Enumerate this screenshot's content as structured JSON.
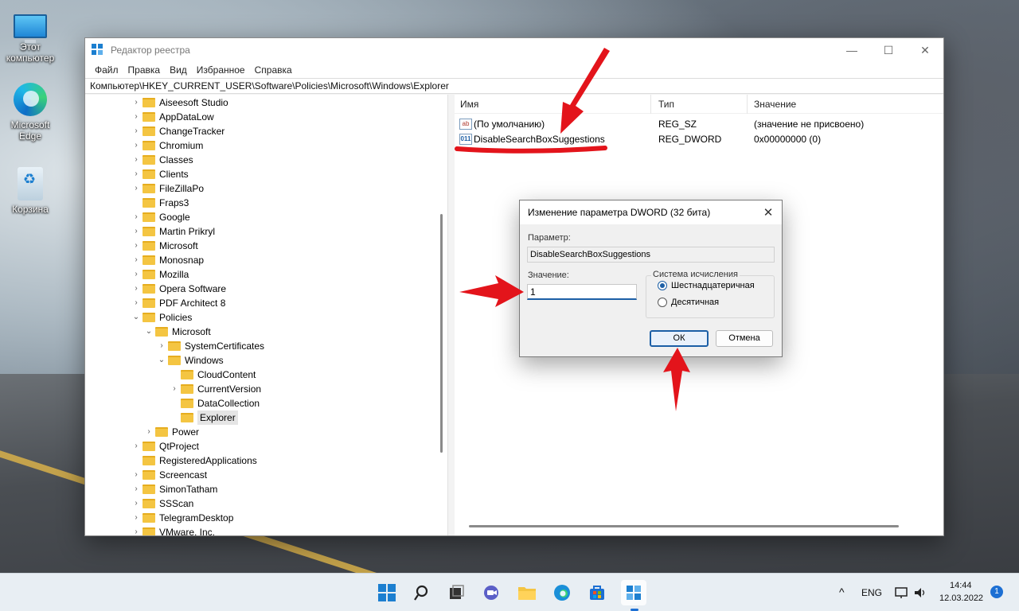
{
  "desktop": {
    "icons": [
      {
        "label": "Этот компьютер",
        "icon": "computer-icon"
      },
      {
        "label": "Microsoft Edge",
        "icon": "edge-icon"
      },
      {
        "label": "Корзина",
        "icon": "recycle-bin-icon"
      }
    ]
  },
  "window": {
    "title": "Редактор реестра",
    "menu": [
      "Файл",
      "Правка",
      "Вид",
      "Избранное",
      "Справка"
    ],
    "address": "Компьютер\\HKEY_CURRENT_USER\\Software\\Policies\\Microsoft\\Windows\\Explorer",
    "controls": {
      "minimize": "—",
      "maximize": "☐",
      "close": "✕"
    }
  },
  "tree": {
    "items": [
      {
        "label": "Aiseesoft Studio"
      },
      {
        "label": "AppDataLow"
      },
      {
        "label": "ChangeTracker"
      },
      {
        "label": "Chromium"
      },
      {
        "label": "Classes"
      },
      {
        "label": "Clients"
      },
      {
        "label": "FileZillaPo"
      },
      {
        "label": "Fraps3"
      },
      {
        "label": "Google"
      },
      {
        "label": "Martin Prikryl"
      },
      {
        "label": "Microsoft"
      },
      {
        "label": "Monosnap"
      },
      {
        "label": "Mozilla"
      },
      {
        "label": "Opera Software"
      },
      {
        "label": "PDF Architect 8"
      },
      {
        "label": "Policies"
      },
      {
        "label": "Microsoft"
      },
      {
        "label": "SystemCertificates"
      },
      {
        "label": "Windows"
      },
      {
        "label": "CloudContent"
      },
      {
        "label": "CurrentVersion"
      },
      {
        "label": "DataCollection"
      },
      {
        "label": "Explorer"
      },
      {
        "label": "Power"
      },
      {
        "label": "QtProject"
      },
      {
        "label": "RegisteredApplications"
      },
      {
        "label": "Screencast"
      },
      {
        "label": "SimonTatham"
      },
      {
        "label": "SSScan"
      },
      {
        "label": "TelegramDesktop"
      },
      {
        "label": "VMware, Inc."
      }
    ]
  },
  "list": {
    "columns": {
      "name": "Имя",
      "type": "Тип",
      "value": "Значение"
    },
    "rows": [
      {
        "name": "(По умолчанию)",
        "type": "REG_SZ",
        "value": "(значение не присвоено)",
        "icon": "ab"
      },
      {
        "name": "DisableSearchBoxSuggestions",
        "type": "REG_DWORD",
        "value": "0x00000000 (0)",
        "icon": "011"
      }
    ]
  },
  "dialog": {
    "title": "Изменение параметра DWORD (32 бита)",
    "param_label": "Параметр:",
    "param_value": "DisableSearchBoxSuggestions",
    "value_label": "Значение:",
    "value": "1",
    "base_label": "Система исчисления",
    "base_options": [
      "Шестнадцатеричная",
      "Десятичная"
    ],
    "base_selected": "Шестнадцатеричная",
    "ok": "ОК",
    "cancel": "Отмена"
  },
  "taskbar": {
    "language": "ENG",
    "time": "14:44",
    "date": "12.03.2022",
    "notifications": "1",
    "chevron": "^"
  },
  "annotation_color": "#e3141b"
}
